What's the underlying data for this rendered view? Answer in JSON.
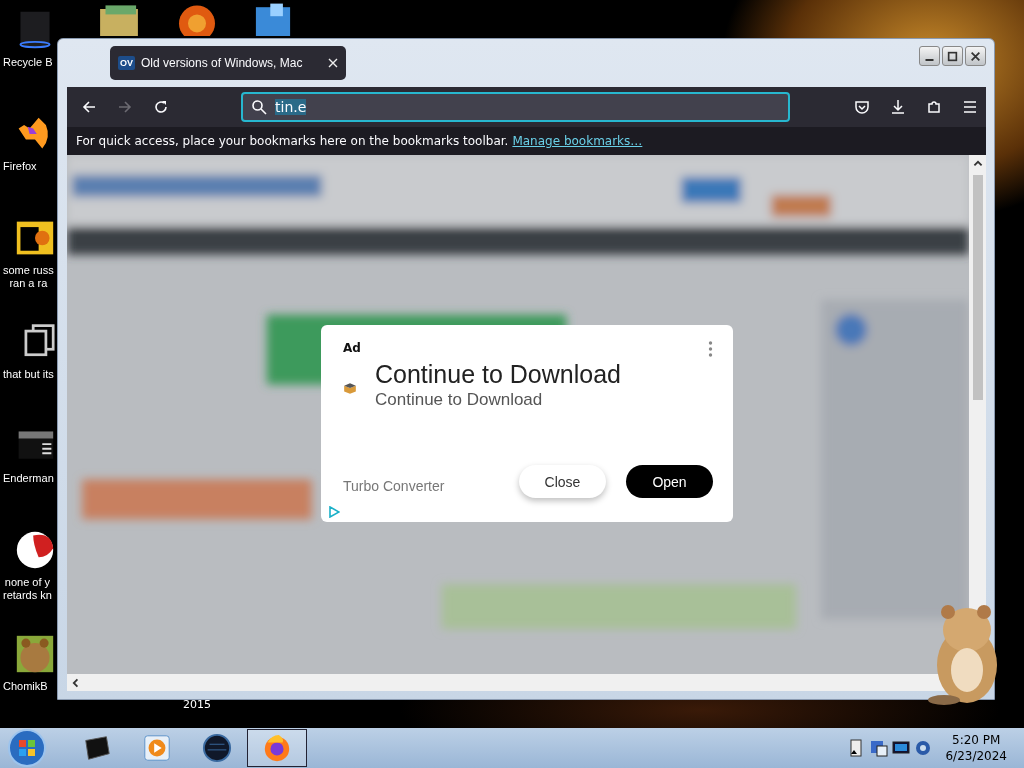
{
  "desktop": {
    "icons": [
      {
        "kind": "bin",
        "label": "Recycle B"
      },
      {
        "kind": "browser",
        "label": "Firefox"
      },
      {
        "kind": "file",
        "label": "some russ\nran a ra"
      },
      {
        "kind": "stack",
        "label": "that but its"
      },
      {
        "kind": "console",
        "label": "Enderman"
      },
      {
        "kind": "disc",
        "label": "none of y\nretards kn"
      },
      {
        "label": "ChomikB"
      }
    ],
    "stray_text": "2015"
  },
  "browser": {
    "tab": {
      "favicon": "OV",
      "title": "Old versions of Windows, Mac",
      "selected": true
    },
    "forward": {
      "disabled": true
    },
    "address": {
      "value": "tin.e",
      "text_selected": true
    },
    "bookmarks_bar": {
      "message": "For quick access, place your bookmarks here on the bookmarks toolbar.",
      "link": "Manage bookmarks…"
    },
    "ad": {
      "badge": "Ad",
      "title": "Continue to Download",
      "subtitle": "Continue to Download",
      "advertiser": "Turbo Converter",
      "buttons": [
        {
          "kind": "secondary",
          "label": "Close"
        },
        {
          "kind": "primary",
          "label": "Open"
        }
      ]
    }
  },
  "taskbar": {
    "apps": [
      {
        "kind": "console",
        "selected": false
      },
      {
        "kind": "player",
        "selected": false
      },
      {
        "kind": "globe",
        "selected": false
      },
      {
        "kind": "browser",
        "selected": true
      }
    ],
    "clock": {
      "time": "5:20 PM",
      "date": "6/23/2024"
    }
  }
}
